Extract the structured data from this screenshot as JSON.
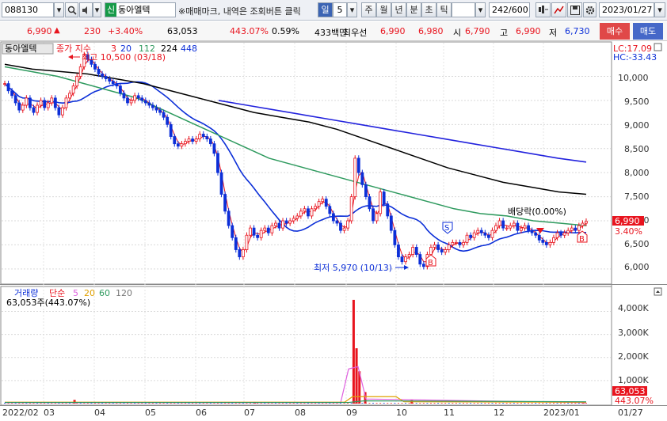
{
  "toolbar": {
    "code": "088130",
    "badge": "신",
    "name": "동아엘텍",
    "notice": "※매매마크, 내역은 조회버튼 클릭",
    "period_label": "일",
    "period_value": "5",
    "tabs": [
      "주",
      "월",
      "년",
      "분",
      "초",
      "틱"
    ],
    "count": "242",
    "count_max": "/600",
    "date": "2023/01/27"
  },
  "quote": {
    "price": "6,990",
    "up_mark": "▲",
    "change": "230",
    "change_pct": "+3.40%",
    "volume": "63,053",
    "volume_ratio": "443.07%",
    "turnover": "0.59%",
    "amount": "433백만",
    "best_ask_label": "최우선",
    "best_ask": "6,990",
    "best_bid": "6,980",
    "open_label": "시",
    "open": "6,790",
    "high_label": "고",
    "high": "6,990",
    "low_label": "저",
    "low": "6,730",
    "buy_label": "매수",
    "sell_label": "매도"
  },
  "colors": {
    "up": "#e8141e",
    "down": "#0c2fd8",
    "ma3": "#e8141e",
    "ma20": "#0c2fd8",
    "ma112": "#2e9a5e",
    "ma224": "#000000",
    "ma448": "#2222dd"
  },
  "price_panel": {
    "stock_name": "동아엘텍",
    "ma_prefix": "종가 지수",
    "ma_labels": [
      "3",
      "20",
      "112",
      "224",
      "448"
    ],
    "lc": "LC:17.09",
    "hc": "HC:-33.43",
    "high_annotation": "최고 10,500 (03/18)",
    "low_annotation": "최저 5,970 (10/13)",
    "dividend_annotation": "배당락(0.00%)",
    "last_price_tag": "6,990",
    "last_pct_tag": "3.40%",
    "y_ticks": [
      "10,000",
      "9,500",
      "9,000",
      "8,500",
      "8,000",
      "7,500",
      "7,000",
      "6,500",
      "6,000"
    ],
    "markers": [
      "S",
      "B",
      "B"
    ]
  },
  "volume_panel": {
    "title": "거래량",
    "ma_prefix": "단순",
    "ma_labels": [
      "5",
      "20",
      "60",
      "120"
    ],
    "current": "63,053주(443.07%)",
    "y_ticks": [
      "4,000K",
      "3,000K",
      "2,000K",
      "1,000K"
    ],
    "last_volume_tag": "63,053",
    "last_pct_tag": "443.07%"
  },
  "x_axis": {
    "labels": [
      "2022/02",
      "03",
      "04",
      "05",
      "06",
      "07",
      "08",
      "09",
      "10",
      "11",
      "12",
      "2023/01"
    ],
    "right_label": "01/27"
  },
  "chart_data": {
    "type": "candlestick",
    "y_range": [
      5800,
      10600
    ],
    "closes": [
      9850,
      9700,
      9600,
      9450,
      9300,
      9400,
      9550,
      9350,
      9250,
      9400,
      9500,
      9350,
      9450,
      9550,
      9350,
      9200,
      9350,
      9550,
      9650,
      9800,
      10000,
      10200,
      10450,
      10350,
      10250,
      10150,
      10050,
      10000,
      9950,
      9900,
      9850,
      9800,
      9650,
      9550,
      9450,
      9500,
      9600,
      9550,
      9500,
      9450,
      9400,
      9350,
      9300,
      9250,
      9150,
      9000,
      8750,
      8600,
      8550,
      8600,
      8650,
      8700,
      8650,
      8700,
      8800,
      8750,
      8700,
      8600,
      8400,
      8000,
      7550,
      7200,
      6900,
      6650,
      6400,
      6250,
      6400,
      6700,
      6850,
      6700,
      6650,
      6800,
      6850,
      6750,
      6900,
      6950,
      6850,
      7000,
      6950,
      7000,
      7050,
      7100,
      7200,
      7250,
      7100,
      7250,
      7300,
      7400,
      7450,
      7300,
      7150,
      7000,
      6950,
      6800,
      6850,
      7000,
      7500,
      8300,
      8000,
      7750,
      7500,
      7250,
      7000,
      7150,
      7600,
      7350,
      7100,
      6800,
      6500,
      6250,
      6150,
      6250,
      6300,
      6450,
      6300,
      6100,
      6050,
      6300,
      6450,
      6500,
      6400,
      6350,
      6400,
      6500,
      6550,
      6550,
      6500,
      6550,
      6700,
      6650,
      6750,
      6800,
      6750,
      6700,
      6650,
      6800,
      6900,
      7000,
      6850,
      6850,
      6900,
      6950,
      6800,
      6850,
      6900,
      6800,
      6750,
      6700,
      6600,
      6550,
      6500,
      6550,
      6650,
      6750,
      6700,
      6750,
      6800,
      6850,
      6800,
      6900,
      6950,
      6990
    ],
    "moving_averages": [
      {
        "name": "3",
        "color": "#e8141e"
      },
      {
        "name": "20",
        "color": "#0c2fd8"
      },
      {
        "name": "112",
        "color": "#2e9a5e",
        "values": [
          10200,
          10100,
          10000,
          9850,
          9700,
          9550,
          9300,
          9050,
          8800,
          8550,
          8300,
          8150,
          8000,
          7850,
          7700,
          7550,
          7400,
          7250,
          7150,
          7100,
          7000,
          6950,
          6900
        ]
      },
      {
        "name": "224",
        "color": "#000000",
        "values": [
          10250,
          10150,
          10100,
          10050,
          9950,
          9850,
          9700,
          9550,
          9400,
          9250,
          9150,
          9050,
          8900,
          8700,
          8500,
          8300,
          8100,
          7950,
          7800,
          7700,
          7600,
          7550
        ]
      },
      {
        "name": "448",
        "color": "#2222dd",
        "values": [
          9500,
          9400,
          9300,
          9200,
          9100,
          9000,
          8900,
          8800,
          8700,
          8600,
          8500,
          8400,
          8300,
          8220
        ]
      }
    ],
    "volume": {
      "y_range": [
        0,
        4600
      ],
      "unit": "K",
      "spikes": [
        {
          "at": 0.12,
          "value": 160
        },
        {
          "at": 0.43,
          "value": 70
        },
        {
          "at": 0.6,
          "value": 4500
        },
        {
          "at": 0.605,
          "value": 2400
        },
        {
          "at": 0.61,
          "value": 1400
        },
        {
          "at": 0.62,
          "value": 500
        },
        {
          "at": 0.7,
          "value": 150
        },
        {
          "at": 0.995,
          "value": 63
        }
      ]
    }
  }
}
